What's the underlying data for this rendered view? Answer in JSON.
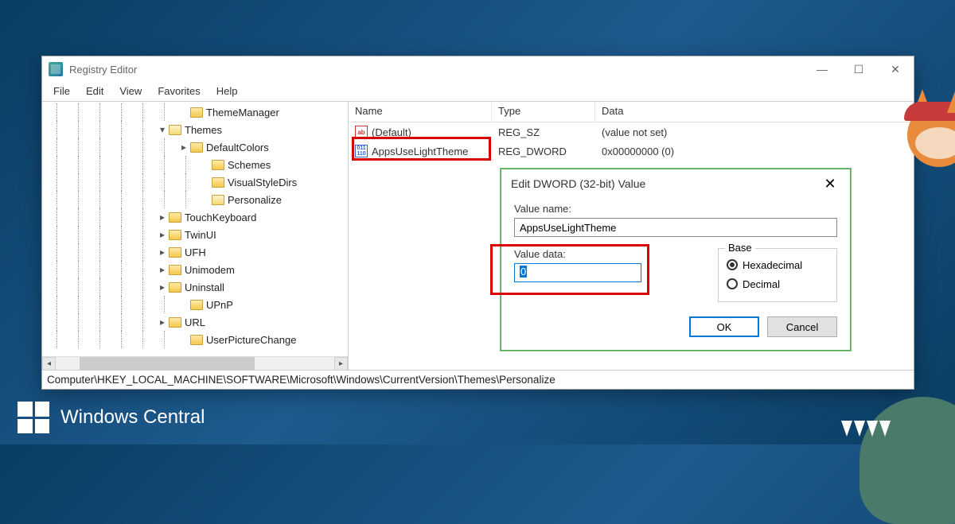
{
  "window": {
    "title": "Registry Editor",
    "controls": {
      "minimize": "—",
      "maximize": "☐",
      "close": "✕"
    }
  },
  "menu": [
    "File",
    "Edit",
    "View",
    "Favorites",
    "Help"
  ],
  "tree": [
    {
      "indent": 6,
      "expander": "",
      "label": "ThemeManager"
    },
    {
      "indent": 5,
      "expander": "▾",
      "label": "Themes",
      "open": true
    },
    {
      "indent": 6,
      "expander": "▸",
      "label": "DefaultColors"
    },
    {
      "indent": 7,
      "expander": "",
      "label": "Schemes"
    },
    {
      "indent": 7,
      "expander": "",
      "label": "VisualStyleDirs"
    },
    {
      "indent": 7,
      "expander": "",
      "label": "Personalize",
      "open": true
    },
    {
      "indent": 5,
      "expander": "▸",
      "label": "TouchKeyboard"
    },
    {
      "indent": 5,
      "expander": "▸",
      "label": "TwinUI"
    },
    {
      "indent": 5,
      "expander": "▸",
      "label": "UFH"
    },
    {
      "indent": 5,
      "expander": "▸",
      "label": "Unimodem"
    },
    {
      "indent": 5,
      "expander": "▸",
      "label": "Uninstall"
    },
    {
      "indent": 6,
      "expander": "",
      "label": "UPnP"
    },
    {
      "indent": 5,
      "expander": "▸",
      "label": "URL"
    },
    {
      "indent": 6,
      "expander": "",
      "label": "UserPictureChange"
    }
  ],
  "list": {
    "headers": {
      "name": "Name",
      "type": "Type",
      "data": "Data"
    },
    "rows": [
      {
        "icon": "ab",
        "name": "(Default)",
        "type": "REG_SZ",
        "data": "(value not set)"
      },
      {
        "icon": "dw",
        "name": "AppsUseLightTheme",
        "type": "REG_DWORD",
        "data": "0x00000000 (0)"
      }
    ]
  },
  "dialog": {
    "title": "Edit DWORD (32-bit) Value",
    "value_name_label": "Value name:",
    "value_name": "AppsUseLightTheme",
    "value_data_label": "Value data:",
    "value_data": "0",
    "base_label": "Base",
    "radio_hex": "Hexadecimal",
    "radio_dec": "Decimal",
    "ok": "OK",
    "cancel": "Cancel",
    "close": "✕"
  },
  "status_path": "Computer\\HKEY_LOCAL_MACHINE\\SOFTWARE\\Microsoft\\Windows\\CurrentVersion\\Themes\\Personalize",
  "watermark": "Windows Central"
}
